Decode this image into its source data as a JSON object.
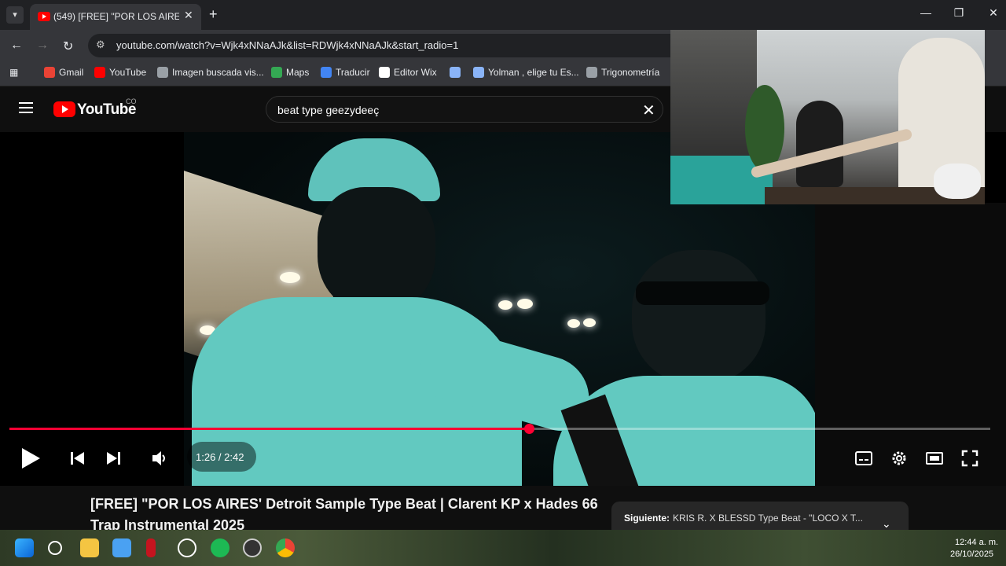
{
  "browser": {
    "tab": {
      "title": "(549) [FREE] \"POR LOS AIRES' D",
      "close": "✕"
    },
    "new_tab": "+",
    "window": {
      "minimize": "—",
      "maximize": "❐",
      "close": "✕"
    },
    "nav": {
      "back": "←",
      "forward": "→",
      "reload": "↻"
    },
    "url": "youtube.com/watch?v=Wjk4xNNaAJk&list=RDWjk4xNNaAJk&start_radio=1",
    "bookmarks": [
      {
        "label": "Gmail",
        "color": "#ea4335"
      },
      {
        "label": "YouTube",
        "color": "#ff0000"
      },
      {
        "label": "Imagen buscada vis...",
        "color": "#9aa0a6"
      },
      {
        "label": "Maps",
        "color": "#34a853"
      },
      {
        "label": "Traducir",
        "color": "#4285f4"
      },
      {
        "label": "Editor Wix",
        "color": "#ffffff"
      },
      {
        "label": "",
        "color": "#8ab4f8"
      },
      {
        "label": "Yolman , elige tu Es...",
        "color": "#8ab4f8"
      },
      {
        "label": "Trigonometría",
        "color": "#9aa0a6"
      }
    ]
  },
  "youtube": {
    "logo_text": "YouTube",
    "country": "CO",
    "search_query": "beat type geezydeeç",
    "search_clear": "✕"
  },
  "player": {
    "current_time": "1:26",
    "duration": "2:42",
    "time_display": "1:26 / 2:42",
    "progress": 0.53
  },
  "video": {
    "title": "[FREE] \"POR LOS AIRES' Detroit Sample Type Beat | Clarent KP x Hades 66 Trap Instrumental 2025",
    "next_label": "Siguiente:",
    "next_title": "KRIS R. X BLESSD Type Beat - \"LOCO X T..."
  },
  "taskbar": {
    "time": "12:44 a. m.",
    "date": "26/10/2025"
  },
  "colors": {
    "accent": "#ff0033",
    "youtube_red": "#ff0000"
  }
}
